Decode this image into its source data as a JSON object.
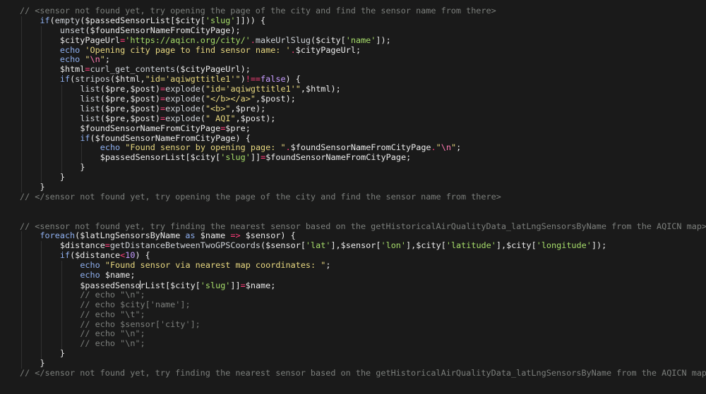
{
  "editor": {
    "colors": {
      "background": "#1a1a1a",
      "comment": "#7c7f7c",
      "keyword": "#8fb0f0",
      "variable": "#ececec",
      "string": "#e8d880",
      "array_key": "#a7dd6a",
      "operator": "#ff3d7a",
      "number": "#c79dff"
    },
    "lines": [
      {
        "indent": 0,
        "tokens": [
          [
            "comment",
            "// <sensor not found yet, try opening the page of the city and find the sensor name from there>"
          ]
        ]
      },
      {
        "indent": 1,
        "tokens": [
          [
            "keyword",
            "if"
          ],
          [
            "punct",
            "("
          ],
          [
            "func",
            "empty"
          ],
          [
            "punct",
            "("
          ],
          [
            "var",
            "$passedSensorList"
          ],
          [
            "punct",
            "["
          ],
          [
            "var",
            "$city"
          ],
          [
            "punct",
            "["
          ],
          [
            "strkey",
            "'slug'"
          ],
          [
            "punct",
            "]])) {"
          ]
        ]
      },
      {
        "indent": 2,
        "tokens": [
          [
            "func",
            "unset"
          ],
          [
            "punct",
            "("
          ],
          [
            "var",
            "$foundSensorNameFromCityPage"
          ],
          [
            "punct",
            ");"
          ]
        ]
      },
      {
        "indent": 2,
        "tokens": [
          [
            "var",
            "$cityPageUrl"
          ],
          [
            "op",
            "="
          ],
          [
            "strkey",
            "'https://aqicn.org/city/'"
          ],
          [
            "op",
            "."
          ],
          [
            "func",
            "makeUrlSlug"
          ],
          [
            "punct",
            "("
          ],
          [
            "var",
            "$city"
          ],
          [
            "punct",
            "["
          ],
          [
            "strkey",
            "'name'"
          ],
          [
            "punct",
            "]);"
          ]
        ]
      },
      {
        "indent": 2,
        "tokens": [
          [
            "keyword",
            "echo"
          ],
          [
            "plain",
            " "
          ],
          [
            "string",
            "'Opening city page to find sensor name: '"
          ],
          [
            "op",
            "."
          ],
          [
            "var",
            "$cityPageUrl"
          ],
          [
            "punct",
            ";"
          ]
        ]
      },
      {
        "indent": 2,
        "tokens": [
          [
            "keyword",
            "echo"
          ],
          [
            "plain",
            " "
          ],
          [
            "string",
            "\""
          ],
          [
            "esc",
            "\\n"
          ],
          [
            "string",
            "\""
          ],
          [
            "punct",
            ";"
          ]
        ]
      },
      {
        "indent": 2,
        "tokens": [
          [
            "var",
            "$html"
          ],
          [
            "op",
            "="
          ],
          [
            "func",
            "curl_get_contents"
          ],
          [
            "punct",
            "("
          ],
          [
            "var",
            "$cityPageUrl"
          ],
          [
            "punct",
            ");"
          ]
        ]
      },
      {
        "indent": 2,
        "tokens": [
          [
            "keyword",
            "if"
          ],
          [
            "punct",
            "("
          ],
          [
            "func",
            "stripos"
          ],
          [
            "punct",
            "("
          ],
          [
            "var",
            "$html"
          ],
          [
            "punct",
            ","
          ],
          [
            "string",
            "\"id='aqiwgttitle1'\""
          ],
          [
            "punct",
            ")"
          ],
          [
            "op",
            "!=="
          ],
          [
            "bool",
            "false"
          ],
          [
            "punct",
            ") {"
          ]
        ]
      },
      {
        "indent": 3,
        "tokens": [
          [
            "func",
            "list"
          ],
          [
            "punct",
            "("
          ],
          [
            "var",
            "$pre"
          ],
          [
            "punct",
            ","
          ],
          [
            "var",
            "$post"
          ],
          [
            "punct",
            ")"
          ],
          [
            "op",
            "="
          ],
          [
            "func",
            "explode"
          ],
          [
            "punct",
            "("
          ],
          [
            "string",
            "\"id='aqiwgttitle1'\""
          ],
          [
            "punct",
            ","
          ],
          [
            "var",
            "$html"
          ],
          [
            "punct",
            ");"
          ]
        ]
      },
      {
        "indent": 3,
        "tokens": [
          [
            "func",
            "list"
          ],
          [
            "punct",
            "("
          ],
          [
            "var",
            "$pre"
          ],
          [
            "punct",
            ","
          ],
          [
            "var",
            "$post"
          ],
          [
            "punct",
            ")"
          ],
          [
            "op",
            "="
          ],
          [
            "func",
            "explode"
          ],
          [
            "punct",
            "("
          ],
          [
            "string",
            "\"</b></a>\""
          ],
          [
            "punct",
            ","
          ],
          [
            "var",
            "$post"
          ],
          [
            "punct",
            ");"
          ]
        ]
      },
      {
        "indent": 3,
        "tokens": [
          [
            "func",
            "list"
          ],
          [
            "punct",
            "("
          ],
          [
            "var",
            "$pre"
          ],
          [
            "punct",
            ","
          ],
          [
            "var",
            "$post"
          ],
          [
            "punct",
            ")"
          ],
          [
            "op",
            "="
          ],
          [
            "func",
            "explode"
          ],
          [
            "punct",
            "("
          ],
          [
            "string",
            "\"<b>\""
          ],
          [
            "punct",
            ","
          ],
          [
            "var",
            "$pre"
          ],
          [
            "punct",
            ");"
          ]
        ]
      },
      {
        "indent": 3,
        "tokens": [
          [
            "func",
            "list"
          ],
          [
            "punct",
            "("
          ],
          [
            "var",
            "$pre"
          ],
          [
            "punct",
            ","
          ],
          [
            "var",
            "$post"
          ],
          [
            "punct",
            ")"
          ],
          [
            "op",
            "="
          ],
          [
            "func",
            "explode"
          ],
          [
            "punct",
            "("
          ],
          [
            "string",
            "\" AQI\""
          ],
          [
            "punct",
            ","
          ],
          [
            "var",
            "$post"
          ],
          [
            "punct",
            ");"
          ]
        ]
      },
      {
        "indent": 3,
        "tokens": [
          [
            "var",
            "$foundSensorNameFromCityPage"
          ],
          [
            "op",
            "="
          ],
          [
            "var",
            "$pre"
          ],
          [
            "punct",
            ";"
          ]
        ]
      },
      {
        "indent": 3,
        "tokens": [
          [
            "keyword",
            "if"
          ],
          [
            "punct",
            "("
          ],
          [
            "var",
            "$foundSensorNameFromCityPage"
          ],
          [
            "punct",
            ") {"
          ]
        ]
      },
      {
        "indent": 4,
        "tokens": [
          [
            "keyword",
            "echo"
          ],
          [
            "plain",
            " "
          ],
          [
            "string",
            "\"Found sensor by opening page: \""
          ],
          [
            "op",
            "."
          ],
          [
            "var",
            "$foundSensorNameFromCityPage"
          ],
          [
            "op",
            "."
          ],
          [
            "string",
            "\""
          ],
          [
            "esc",
            "\\n"
          ],
          [
            "string",
            "\""
          ],
          [
            "punct",
            ";"
          ]
        ]
      },
      {
        "indent": 4,
        "tokens": [
          [
            "var",
            "$passedSensorList"
          ],
          [
            "punct",
            "["
          ],
          [
            "var",
            "$city"
          ],
          [
            "punct",
            "["
          ],
          [
            "strkey",
            "'slug'"
          ],
          [
            "punct",
            "]]"
          ],
          [
            "op",
            "="
          ],
          [
            "var",
            "$foundSensorNameFromCityPage"
          ],
          [
            "punct",
            ";"
          ]
        ]
      },
      {
        "indent": 3,
        "tokens": [
          [
            "punct",
            "}"
          ]
        ]
      },
      {
        "indent": 2,
        "tokens": [
          [
            "punct",
            "}"
          ]
        ]
      },
      {
        "indent": 1,
        "tokens": [
          [
            "punct",
            "}"
          ]
        ]
      },
      {
        "indent": 0,
        "tokens": [
          [
            "comment",
            "// </sensor not found yet, try opening the page of the city and find the sensor name from there>"
          ]
        ]
      },
      {
        "indent": 0,
        "tokens": []
      },
      {
        "indent": 0,
        "tokens": []
      },
      {
        "indent": 0,
        "tokens": [
          [
            "comment",
            "// <sensor not found yet, try finding the nearest sensor based on the getHistoricalAirQualityData_latLngSensorsByName from the AQICN map>"
          ]
        ]
      },
      {
        "indent": 1,
        "tokens": [
          [
            "keyword",
            "foreach"
          ],
          [
            "punct",
            "("
          ],
          [
            "var",
            "$latLngSensorsByName"
          ],
          [
            "plain",
            " "
          ],
          [
            "keyword",
            "as"
          ],
          [
            "plain",
            " "
          ],
          [
            "var",
            "$name"
          ],
          [
            "plain",
            " "
          ],
          [
            "op",
            "=>"
          ],
          [
            "plain",
            " "
          ],
          [
            "var",
            "$sensor"
          ],
          [
            "punct",
            ") {"
          ]
        ]
      },
      {
        "indent": 2,
        "tokens": [
          [
            "var",
            "$distance"
          ],
          [
            "op",
            "="
          ],
          [
            "func",
            "getDistanceBetweenTwoGPSCoords"
          ],
          [
            "punct",
            "("
          ],
          [
            "var",
            "$sensor"
          ],
          [
            "punct",
            "["
          ],
          [
            "strkey",
            "'lat'"
          ],
          [
            "punct",
            "],"
          ],
          [
            "var",
            "$sensor"
          ],
          [
            "punct",
            "["
          ],
          [
            "strkey",
            "'lon'"
          ],
          [
            "punct",
            "],"
          ],
          [
            "var",
            "$city"
          ],
          [
            "punct",
            "["
          ],
          [
            "strkey",
            "'latitude'"
          ],
          [
            "punct",
            "],"
          ],
          [
            "var",
            "$city"
          ],
          [
            "punct",
            "["
          ],
          [
            "strkey",
            "'longitude'"
          ],
          [
            "punct",
            "]);"
          ]
        ]
      },
      {
        "indent": 2,
        "tokens": [
          [
            "keyword",
            "if"
          ],
          [
            "punct",
            "("
          ],
          [
            "var",
            "$distance"
          ],
          [
            "op",
            "<"
          ],
          [
            "number",
            "10"
          ],
          [
            "punct",
            ") {"
          ]
        ]
      },
      {
        "indent": 3,
        "tokens": [
          [
            "keyword",
            "echo"
          ],
          [
            "plain",
            " "
          ],
          [
            "string",
            "\"Found sensor via nearest map coordinates: \""
          ],
          [
            "punct",
            ";"
          ]
        ]
      },
      {
        "indent": 3,
        "tokens": [
          [
            "keyword",
            "echo"
          ],
          [
            "plain",
            " "
          ],
          [
            "var",
            "$name"
          ],
          [
            "punct",
            ";"
          ]
        ]
      },
      {
        "indent": 3,
        "tokens": [
          [
            "var",
            "$passedSenso"
          ],
          [
            "cursor",
            ""
          ],
          [
            "var",
            "rList"
          ],
          [
            "punct",
            "["
          ],
          [
            "var",
            "$city"
          ],
          [
            "punct",
            "["
          ],
          [
            "strkey",
            "'slug'"
          ],
          [
            "punct",
            "]]"
          ],
          [
            "op",
            "="
          ],
          [
            "var",
            "$name"
          ],
          [
            "punct",
            ";"
          ]
        ]
      },
      {
        "indent": 3,
        "tokens": [
          [
            "comment",
            "// echo \"\\n\";"
          ]
        ]
      },
      {
        "indent": 3,
        "tokens": [
          [
            "comment",
            "// echo $city['name'];"
          ]
        ]
      },
      {
        "indent": 3,
        "tokens": [
          [
            "comment",
            "// echo \"\\t\";"
          ]
        ]
      },
      {
        "indent": 3,
        "tokens": [
          [
            "comment",
            "// echo $sensor['city'];"
          ]
        ]
      },
      {
        "indent": 3,
        "tokens": [
          [
            "comment",
            "// echo \"\\n\";"
          ]
        ]
      },
      {
        "indent": 3,
        "tokens": [
          [
            "comment",
            "// echo \"\\n\";"
          ]
        ]
      },
      {
        "indent": 2,
        "tokens": [
          [
            "punct",
            "}"
          ]
        ]
      },
      {
        "indent": 1,
        "tokens": [
          [
            "punct",
            "}"
          ]
        ]
      },
      {
        "indent": 0,
        "tokens": [
          [
            "comment",
            "// </sensor not found yet, try finding the nearest sensor based on the getHistoricalAirQualityData_latLngSensorsByName from the AQICN map>"
          ]
        ]
      }
    ]
  }
}
